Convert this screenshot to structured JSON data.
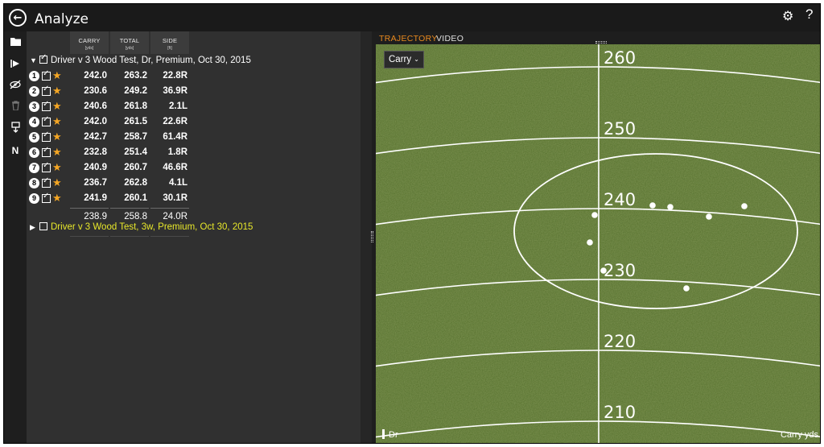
{
  "app": {
    "title": "Analyze"
  },
  "columns": [
    {
      "label": "CARRY",
      "unit": "[yds]"
    },
    {
      "label": "TOTAL",
      "unit": "[yds]"
    },
    {
      "label": "SIDE",
      "unit": "[ft]"
    }
  ],
  "groups": [
    {
      "name": "Driver v 3 Wood Test, Dr, Premium, Oct 30, 2015",
      "expanded": true,
      "checked": true,
      "color": "#ffffff",
      "shots": [
        {
          "n": "1",
          "carry": "242.0",
          "total": "263.2",
          "side": "22.8R"
        },
        {
          "n": "2",
          "carry": "230.6",
          "total": "249.2",
          "side": "36.9R"
        },
        {
          "n": "3",
          "carry": "240.6",
          "total": "261.8",
          "side": "2.1L"
        },
        {
          "n": "4",
          "carry": "242.0",
          "total": "261.5",
          "side": "22.6R"
        },
        {
          "n": "5",
          "carry": "242.7",
          "total": "258.7",
          "side": "61.4R"
        },
        {
          "n": "6",
          "carry": "232.8",
          "total": "251.4",
          "side": "1.8R"
        },
        {
          "n": "7",
          "carry": "240.9",
          "total": "260.7",
          "side": "46.6R"
        },
        {
          "n": "8",
          "carry": "236.7",
          "total": "262.8",
          "side": "4.1L"
        },
        {
          "n": "9",
          "carry": "241.9",
          "total": "260.1",
          "side": "30.1R"
        }
      ],
      "averages": {
        "carry": "238.9",
        "total": "258.8",
        "side": "24.0R"
      }
    },
    {
      "name": "Driver v 3 Wood Test, 3w, Premium, Oct 30, 2015",
      "expanded": false,
      "checked": false,
      "color": "#e8e82a"
    }
  ],
  "viz": {
    "tabs": {
      "trajectory": "TRAJECTORY",
      "video": "VIDEO"
    },
    "metric_select": "Carry",
    "legend_club": "Dr",
    "metric_label": "Carry yds",
    "distance_labels": [
      "260",
      "250",
      "240",
      "230",
      "220",
      "210"
    ],
    "field_color": "#5f7a2e",
    "dot_color": "#ffffff"
  }
}
